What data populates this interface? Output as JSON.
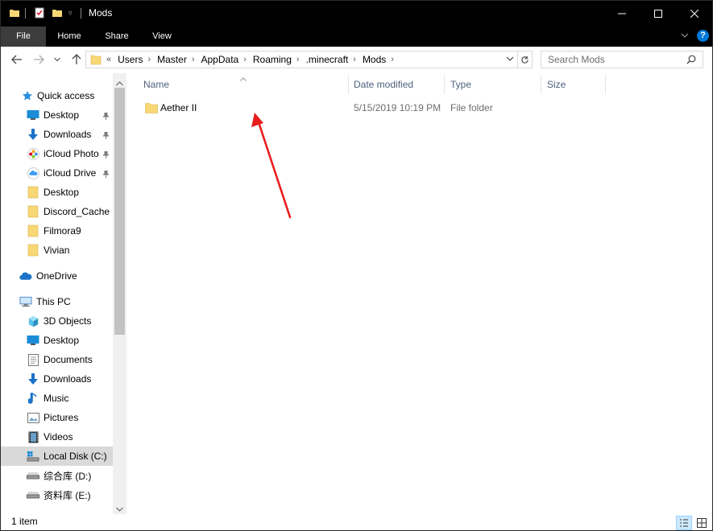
{
  "window": {
    "title": "Mods"
  },
  "ribbon": {
    "tabs": [
      {
        "label": "File"
      },
      {
        "label": "Home"
      },
      {
        "label": "Share"
      },
      {
        "label": "View"
      }
    ]
  },
  "address_bar": {
    "overflow_glyph": "«",
    "crumbs": [
      "Users",
      "Master",
      "AppData",
      "Roaming",
      ".minecraft",
      "Mods"
    ]
  },
  "search": {
    "placeholder": "Search Mods"
  },
  "sidebar": {
    "quick_access_label": "Quick access",
    "quick_access_items": [
      {
        "label": "Desktop",
        "icon": "desktop-icon",
        "pinned": true
      },
      {
        "label": "Downloads",
        "icon": "download-icon",
        "pinned": true
      },
      {
        "label": "iCloud Photo",
        "icon": "icloud-photos-icon",
        "pinned": true
      },
      {
        "label": "iCloud Drive",
        "icon": "icloud-drive-icon",
        "pinned": true
      },
      {
        "label": "Desktop",
        "icon": "folder-icon",
        "pinned": false
      },
      {
        "label": "Discord_Cache",
        "icon": "folder-icon",
        "pinned": false
      },
      {
        "label": "Filmora9",
        "icon": "folder-icon",
        "pinned": false
      },
      {
        "label": "Vivian",
        "icon": "folder-icon",
        "pinned": false
      }
    ],
    "onedrive_label": "OneDrive",
    "this_pc_label": "This PC",
    "this_pc_items": [
      {
        "label": "3D Objects",
        "icon": "3d-objects-icon",
        "selected": false
      },
      {
        "label": "Desktop",
        "icon": "desktop-icon",
        "selected": false
      },
      {
        "label": "Documents",
        "icon": "documents-icon",
        "selected": false
      },
      {
        "label": "Downloads",
        "icon": "download-icon",
        "selected": false
      },
      {
        "label": "Music",
        "icon": "music-icon",
        "selected": false
      },
      {
        "label": "Pictures",
        "icon": "pictures-icon",
        "selected": false
      },
      {
        "label": "Videos",
        "icon": "videos-icon",
        "selected": false
      },
      {
        "label": "Local Disk (C:)",
        "icon": "local-disk-icon",
        "selected": true
      },
      {
        "label": "综合库 (D:)",
        "icon": "drive-icon",
        "selected": false
      },
      {
        "label": "资料库 (E:)",
        "icon": "drive-icon",
        "selected": false
      }
    ]
  },
  "file_list": {
    "columns": [
      "Name",
      "Date modified",
      "Type",
      "Size"
    ],
    "rows": [
      {
        "name": "Aether II",
        "date_modified": "5/15/2019 10:19 PM",
        "type": "File folder",
        "size": ""
      }
    ]
  },
  "status_bar": {
    "item_count": "1 item"
  },
  "colors": {
    "titlebar": "#000000",
    "selection": "#d9d9d9",
    "header_text": "#4c607a",
    "meta_text": "#6d6d6d",
    "folder": "#f8d775",
    "annotation_arrow": "#e81e1e",
    "accent_blue": "#0078d7"
  }
}
